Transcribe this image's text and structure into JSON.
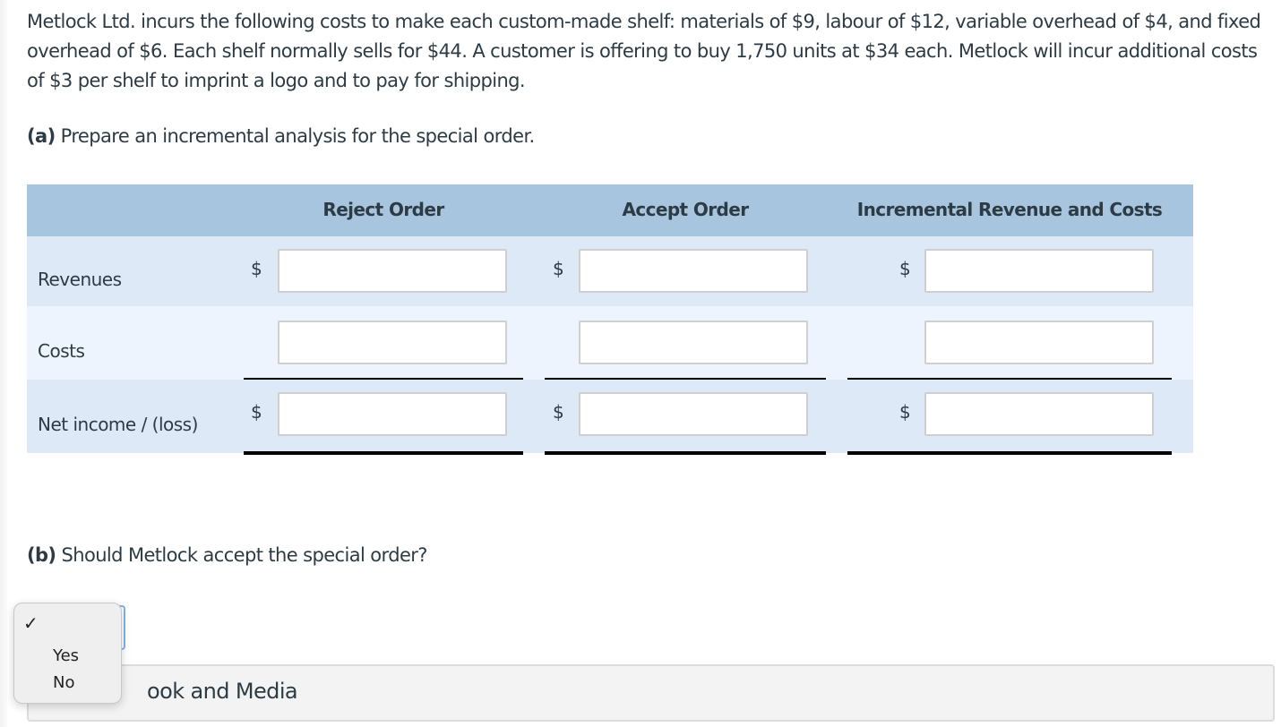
{
  "question": {
    "text": "Metlock Ltd. incurs the following costs to make each custom-made shelf: materials of $9, labour of $12, variable overhead of $4, and fixed overhead of $6. Each shelf normally sells for $44. A customer is offering to buy 1,750 units at $34 each. Metlock will incur additional costs of $3 per shelf to imprint a logo and to pay for shipping."
  },
  "part_a": {
    "label": "(a)",
    "text": "Prepare an incremental analysis for the special order."
  },
  "table": {
    "headers": [
      "",
      "Reject Order",
      "Accept Order",
      "Incremental Revenue and Costs"
    ],
    "currency_symbol": "$",
    "rows": [
      {
        "label": "Revenues",
        "values": [
          "",
          "",
          ""
        ]
      },
      {
        "label": "Costs",
        "values": [
          "",
          "",
          ""
        ]
      },
      {
        "label": "Net income / (loss)",
        "values": [
          "",
          "",
          ""
        ]
      }
    ]
  },
  "part_b": {
    "label": "(b)",
    "text": "Should Metlock accept the special order?",
    "select": {
      "selected": "",
      "options": [
        "",
        "Yes",
        "No"
      ],
      "check_glyph": "✓"
    }
  },
  "resources": {
    "label": "eTextbook and Media",
    "visible_label": "ook and Media"
  },
  "colors": {
    "header_bg": "#a7c5de",
    "row_dark_bg": "#dde9f6",
    "row_light_bg": "#edf4fd",
    "text": "#2d3b45",
    "focus_border": "#7fb4e6"
  }
}
